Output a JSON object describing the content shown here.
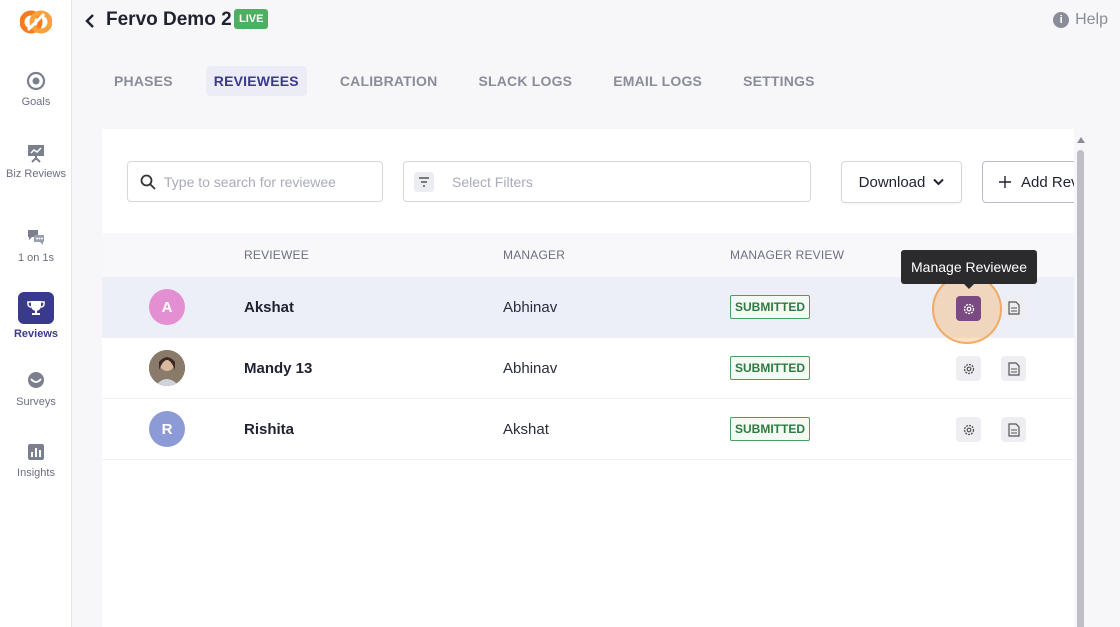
{
  "app": {
    "title": "Fervo Demo 2",
    "live_badge": "LIVE",
    "help_label": "Help",
    "brand_color": "#f47b20",
    "accent_color": "#3a3a8c"
  },
  "sidebar": {
    "items": [
      {
        "label": "Goals",
        "icon": "target-icon"
      },
      {
        "label": "Biz Reviews",
        "icon": "presentation-icon"
      },
      {
        "label": "1 on 1s",
        "icon": "chat-bubbles-icon"
      },
      {
        "label": "Reviews",
        "icon": "trophy-icon",
        "active": true
      },
      {
        "label": "Surveys",
        "icon": "survey-bubble-icon"
      },
      {
        "label": "Insights",
        "icon": "bar-chart-icon"
      }
    ]
  },
  "tabs": [
    {
      "label": "PHASES"
    },
    {
      "label": "REVIEWEES",
      "active": true
    },
    {
      "label": "CALIBRATION"
    },
    {
      "label": "SLACK LOGS"
    },
    {
      "label": "EMAIL LOGS"
    },
    {
      "label": "SETTINGS"
    }
  ],
  "toolbar": {
    "search_placeholder": "Type to search for reviewee",
    "filter_placeholder": "Select Filters",
    "download_label": "Download",
    "add_label": "Add Reviewee"
  },
  "table": {
    "columns": {
      "reviewee": "REVIEWEE",
      "manager": "MANAGER",
      "manager_review": "MANAGER REVIEW"
    },
    "rows": [
      {
        "initial": "A",
        "name": "Akshat",
        "manager": "Abhinav",
        "status": "SUBMITTED",
        "avatar_color": "#e58fd3"
      },
      {
        "initial": "",
        "name": "Mandy 13",
        "manager": "Abhinav",
        "status": "SUBMITTED",
        "avatar_color": "#6b5a4e"
      },
      {
        "initial": "R",
        "name": "Rishita",
        "manager": "Akshat",
        "status": "SUBMITTED",
        "avatar_color": "#8c9bd6"
      }
    ]
  },
  "tooltip": {
    "text": "Manage Reviewee"
  }
}
